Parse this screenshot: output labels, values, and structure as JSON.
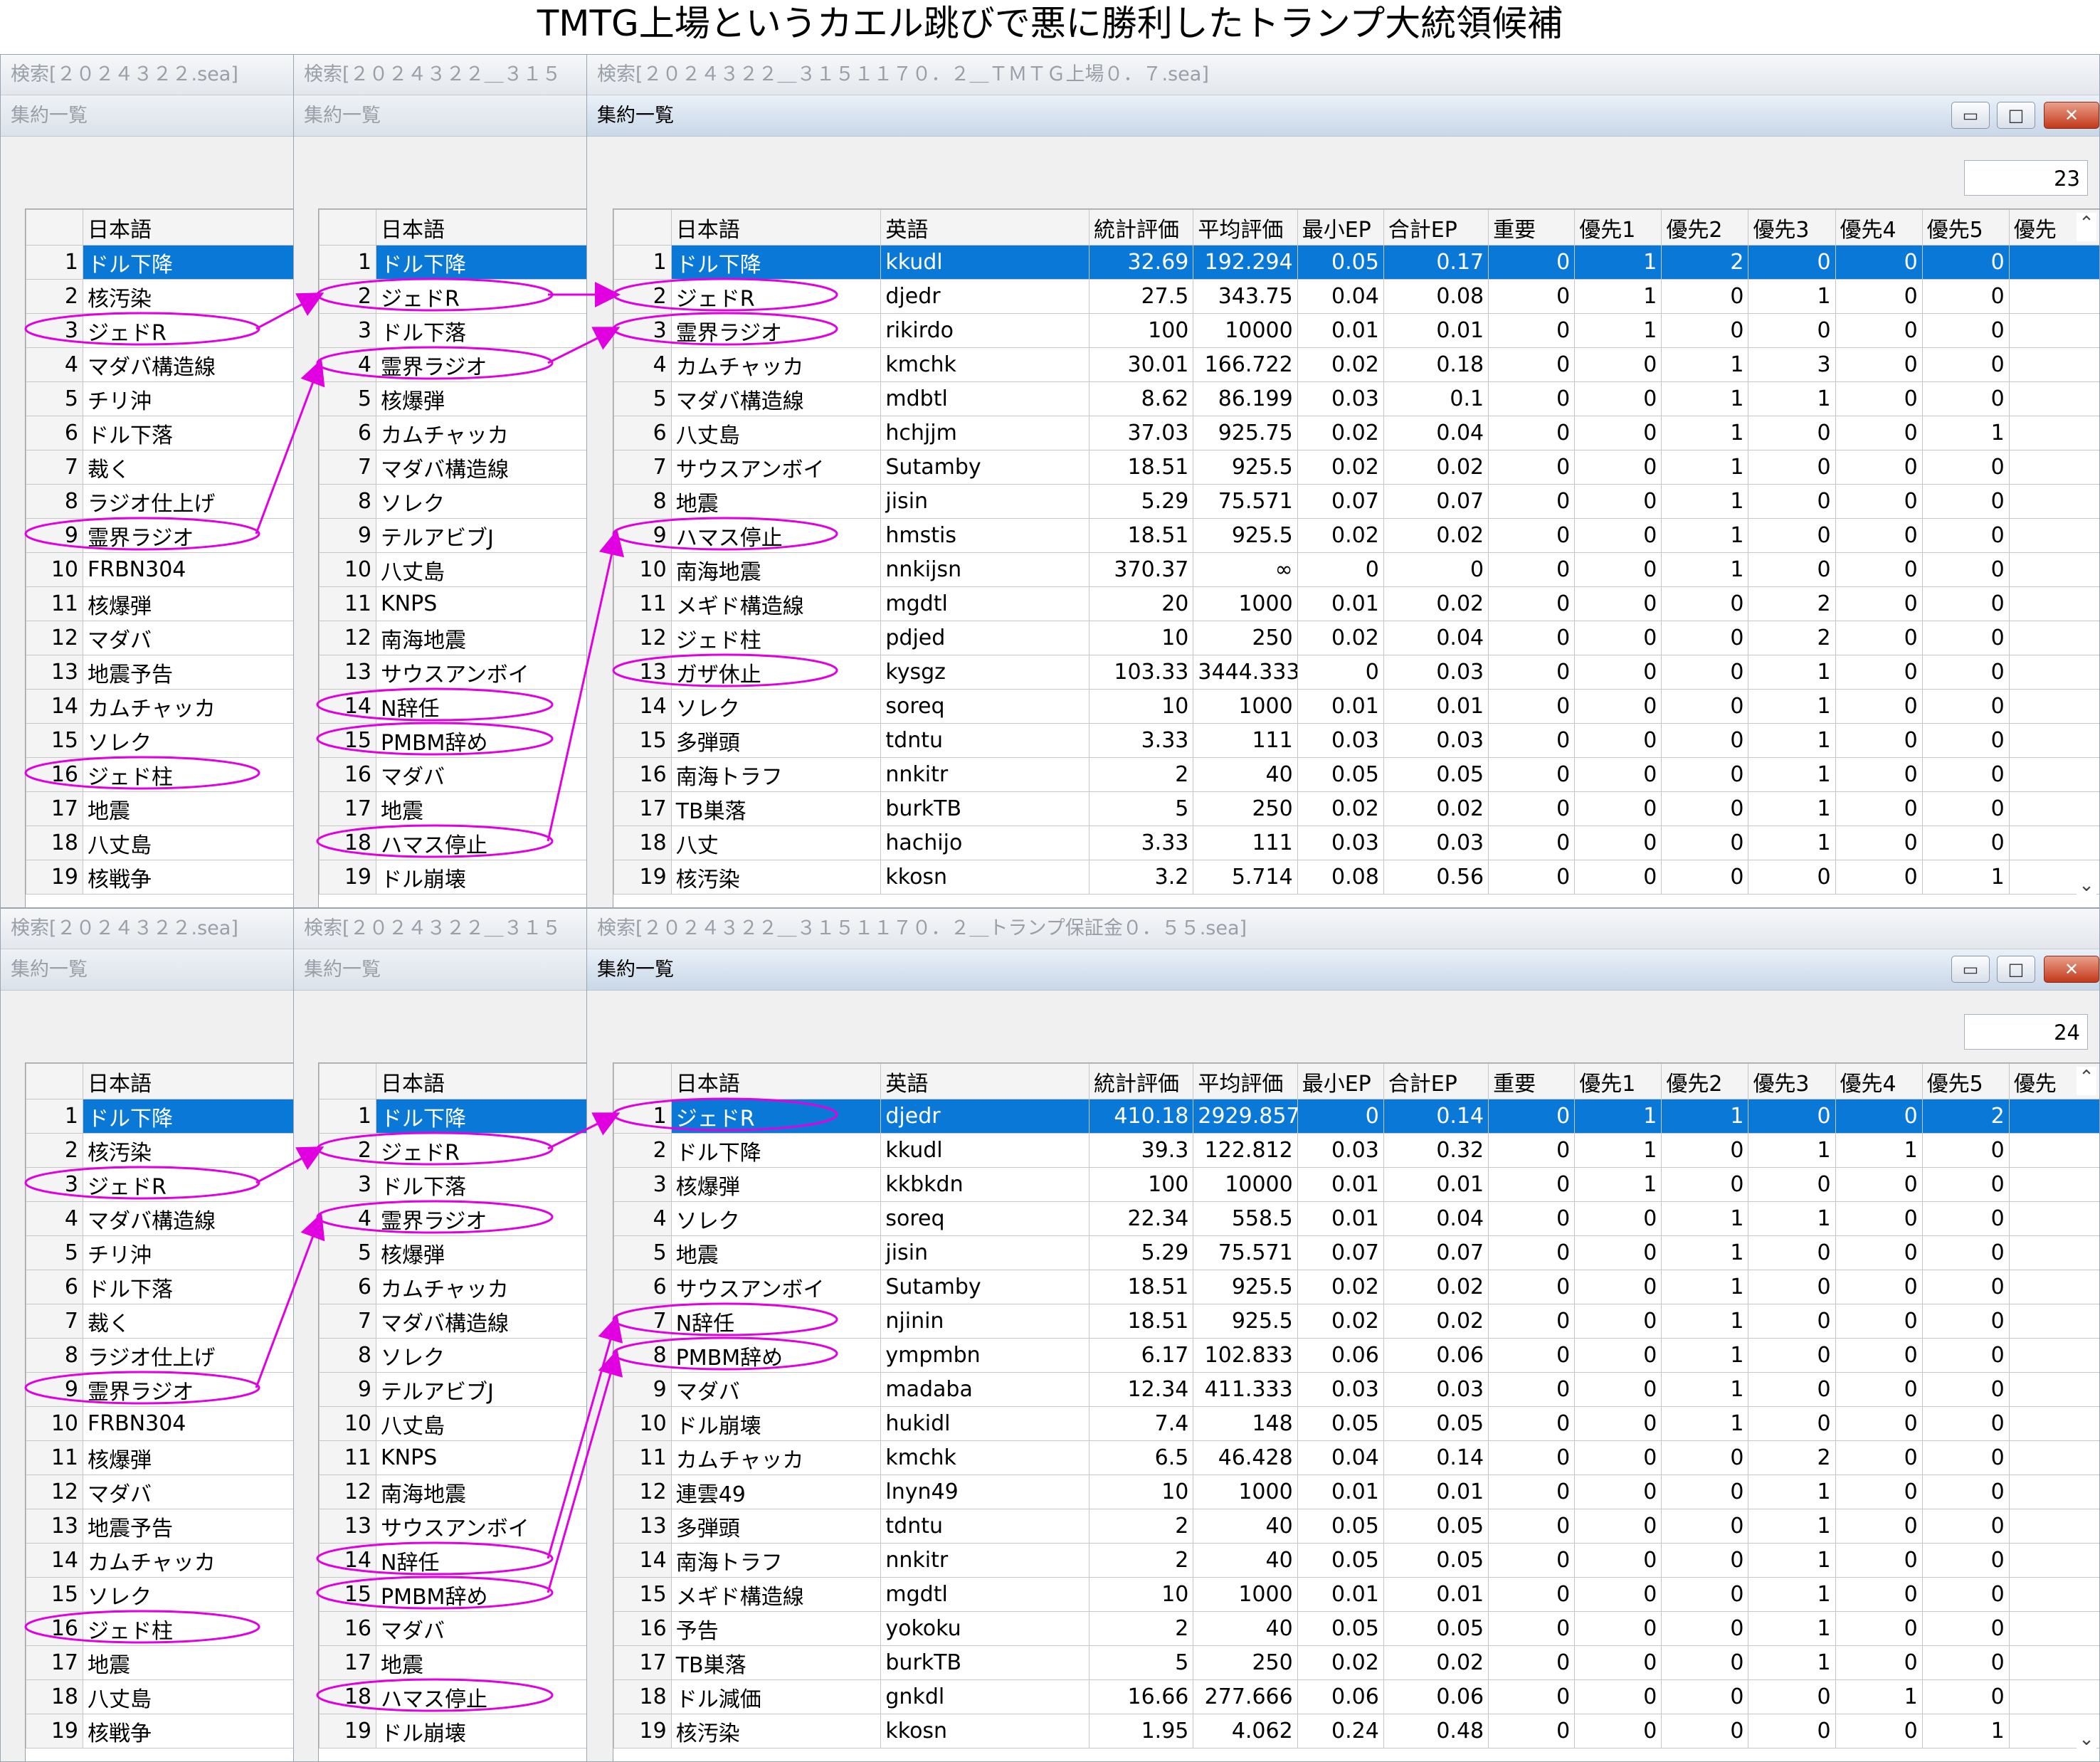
{
  "page_title": "TMTG上場というカエル跳びで悪に勝利したトランプ大統領候補",
  "blocks": [
    {
      "win1_title": "検索[２０２４３２２.sea]",
      "win2_title": "検索[２０２４３２２＿３１５",
      "win3_title": "検索[２０２４３２２＿３１５１１７０．２＿ＴＭＴＧ上場０．７.sea]",
      "sub_title": "集約一覧",
      "count": "23",
      "left_list": [
        "ドル下降",
        "核汚染",
        "ジェドR",
        "マダバ構造線",
        "チリ沖",
        "ドル下落",
        "裁く",
        "ラジオ仕上げ",
        "霊界ラジオ",
        "FRBN304",
        "核爆弾",
        "マダバ",
        "地震予告",
        "カムチャッカ",
        "ソレク",
        "ジェド柱",
        "地震",
        "八丈島",
        "核戦争"
      ],
      "mid_list": [
        "ドル下降",
        "ジェドR",
        "ドル下落",
        "霊界ラジオ",
        "核爆弾",
        "カムチャッカ",
        "マダバ構造線",
        "ソレク",
        "テルアビブJ",
        "八丈島",
        "KNPS",
        "南海地震",
        "サウスアンボイ",
        "N辞任",
        "PMBM辞め",
        "マダバ",
        "地震",
        "ハマス停止",
        "ドル崩壊"
      ],
      "rows": [
        [
          "ドル下降",
          "kkudl",
          "32.69",
          "192.294",
          "0.05",
          "0.17",
          "0",
          "1",
          "2",
          "0",
          "0",
          "0"
        ],
        [
          "ジェドR",
          "djedr",
          "27.5",
          "343.75",
          "0.04",
          "0.08",
          "0",
          "1",
          "0",
          "1",
          "0",
          "0"
        ],
        [
          "霊界ラジオ",
          "rikirdo",
          "100",
          "10000",
          "0.01",
          "0.01",
          "0",
          "1",
          "0",
          "0",
          "0",
          "0"
        ],
        [
          "カムチャッカ",
          "kmchk",
          "30.01",
          "166.722",
          "0.02",
          "0.18",
          "0",
          "0",
          "1",
          "3",
          "0",
          "0"
        ],
        [
          "マダバ構造線",
          "mdbtl",
          "8.62",
          "86.199",
          "0.03",
          "0.1",
          "0",
          "0",
          "1",
          "1",
          "0",
          "0"
        ],
        [
          "八丈島",
          "hchjjm",
          "37.03",
          "925.75",
          "0.02",
          "0.04",
          "0",
          "0",
          "1",
          "0",
          "0",
          "1"
        ],
        [
          "サウスアンボイ",
          "Sutamby",
          "18.51",
          "925.5",
          "0.02",
          "0.02",
          "0",
          "0",
          "1",
          "0",
          "0",
          "0"
        ],
        [
          "地震",
          "jisin",
          "5.29",
          "75.571",
          "0.07",
          "0.07",
          "0",
          "0",
          "1",
          "0",
          "0",
          "0"
        ],
        [
          "ハマス停止",
          "hmstis",
          "18.51",
          "925.5",
          "0.02",
          "0.02",
          "0",
          "0",
          "1",
          "0",
          "0",
          "0"
        ],
        [
          "南海地震",
          "nnkijsn",
          "370.37",
          "∞",
          "0",
          "0",
          "0",
          "0",
          "1",
          "0",
          "0",
          "0"
        ],
        [
          "メギド構造線",
          "mgdtl",
          "20",
          "1000",
          "0.01",
          "0.02",
          "0",
          "0",
          "0",
          "2",
          "0",
          "0"
        ],
        [
          "ジェド柱",
          "pdjed",
          "10",
          "250",
          "0.02",
          "0.04",
          "0",
          "0",
          "0",
          "2",
          "0",
          "0"
        ],
        [
          "ガザ休止",
          "kysgz",
          "103.33",
          "3444.333",
          "0",
          "0.03",
          "0",
          "0",
          "0",
          "1",
          "0",
          "0"
        ],
        [
          "ソレク",
          "soreq",
          "10",
          "1000",
          "0.01",
          "0.01",
          "0",
          "0",
          "0",
          "1",
          "0",
          "0"
        ],
        [
          "多弾頭",
          "tdntu",
          "3.33",
          "111",
          "0.03",
          "0.03",
          "0",
          "0",
          "0",
          "1",
          "0",
          "0"
        ],
        [
          "南海トラフ",
          "nnkitr",
          "2",
          "40",
          "0.05",
          "0.05",
          "0",
          "0",
          "0",
          "1",
          "0",
          "0"
        ],
        [
          "TB巣落",
          "burkTB",
          "5",
          "250",
          "0.02",
          "0.02",
          "0",
          "0",
          "0",
          "1",
          "0",
          "0"
        ],
        [
          "八丈",
          "hachijo",
          "3.33",
          "111",
          "0.03",
          "0.03",
          "0",
          "0",
          "0",
          "1",
          "0",
          "0"
        ],
        [
          "核汚染",
          "kkosn",
          "3.2",
          "5.714",
          "0.08",
          "0.56",
          "0",
          "0",
          "0",
          "0",
          "0",
          "1"
        ]
      ]
    },
    {
      "win1_title": "検索[２０２４３２２.sea]",
      "win2_title": "検索[２０２４３２２＿３１５",
      "win3_title": "検索[２０２４３２２＿３１５１１７０．２＿トランプ保証金０．５５.sea]",
      "sub_title": "集約一覧",
      "count": "24",
      "left_list": [
        "ドル下降",
        "核汚染",
        "ジェドR",
        "マダバ構造線",
        "チリ沖",
        "ドル下落",
        "裁く",
        "ラジオ仕上げ",
        "霊界ラジオ",
        "FRBN304",
        "核爆弾",
        "マダバ",
        "地震予告",
        "カムチャッカ",
        "ソレク",
        "ジェド柱",
        "地震",
        "八丈島",
        "核戦争"
      ],
      "mid_list": [
        "ドル下降",
        "ジェドR",
        "ドル下落",
        "霊界ラジオ",
        "核爆弾",
        "カムチャッカ",
        "マダバ構造線",
        "ソレク",
        "テルアビブJ",
        "八丈島",
        "KNPS",
        "南海地震",
        "サウスアンボイ",
        "N辞任",
        "PMBM辞め",
        "マダバ",
        "地震",
        "ハマス停止",
        "ドル崩壊"
      ],
      "rows": [
        [
          "ジェドR",
          "djedr",
          "410.18",
          "2929.857",
          "0",
          "0.14",
          "0",
          "1",
          "1",
          "0",
          "0",
          "2"
        ],
        [
          "ドル下降",
          "kkudl",
          "39.3",
          "122.812",
          "0.03",
          "0.32",
          "0",
          "1",
          "0",
          "1",
          "1",
          "0"
        ],
        [
          "核爆弾",
          "kkbkdn",
          "100",
          "10000",
          "0.01",
          "0.01",
          "0",
          "1",
          "0",
          "0",
          "0",
          "0"
        ],
        [
          "ソレク",
          "soreq",
          "22.34",
          "558.5",
          "0.01",
          "0.04",
          "0",
          "0",
          "1",
          "1",
          "0",
          "0"
        ],
        [
          "地震",
          "jisin",
          "5.29",
          "75.571",
          "0.07",
          "0.07",
          "0",
          "0",
          "1",
          "0",
          "0",
          "0"
        ],
        [
          "サウスアンボイ",
          "Sutamby",
          "18.51",
          "925.5",
          "0.02",
          "0.02",
          "0",
          "0",
          "1",
          "0",
          "0",
          "0"
        ],
        [
          "N辞任",
          "njinin",
          "18.51",
          "925.5",
          "0.02",
          "0.02",
          "0",
          "0",
          "1",
          "0",
          "0",
          "0"
        ],
        [
          "PMBM辞め",
          "ympmbn",
          "6.17",
          "102.833",
          "0.06",
          "0.06",
          "0",
          "0",
          "1",
          "0",
          "0",
          "0"
        ],
        [
          "マダバ",
          "madaba",
          "12.34",
          "411.333",
          "0.03",
          "0.03",
          "0",
          "0",
          "1",
          "0",
          "0",
          "0"
        ],
        [
          "ドル崩壊",
          "hukidl",
          "7.4",
          "148",
          "0.05",
          "0.05",
          "0",
          "0",
          "1",
          "0",
          "0",
          "0"
        ],
        [
          "カムチャッカ",
          "kmchk",
          "6.5",
          "46.428",
          "0.04",
          "0.14",
          "0",
          "0",
          "0",
          "2",
          "0",
          "0"
        ],
        [
          "連雲49",
          "lnyn49",
          "10",
          "1000",
          "0.01",
          "0.01",
          "0",
          "0",
          "0",
          "1",
          "0",
          "0"
        ],
        [
          "多弾頭",
          "tdntu",
          "2",
          "40",
          "0.05",
          "0.05",
          "0",
          "0",
          "0",
          "1",
          "0",
          "0"
        ],
        [
          "南海トラフ",
          "nnkitr",
          "2",
          "40",
          "0.05",
          "0.05",
          "0",
          "0",
          "0",
          "1",
          "0",
          "0"
        ],
        [
          "メギド構造線",
          "mgdtl",
          "10",
          "1000",
          "0.01",
          "0.01",
          "0",
          "0",
          "0",
          "1",
          "0",
          "0"
        ],
        [
          "予告",
          "yokoku",
          "2",
          "40",
          "0.05",
          "0.05",
          "0",
          "0",
          "0",
          "1",
          "0",
          "0"
        ],
        [
          "TB巣落",
          "burkTB",
          "5",
          "250",
          "0.02",
          "0.02",
          "0",
          "0",
          "0",
          "1",
          "0",
          "0"
        ],
        [
          "ドル減価",
          "gnkdl",
          "16.66",
          "277.666",
          "0.06",
          "0.06",
          "0",
          "0",
          "0",
          "0",
          "1",
          "0"
        ],
        [
          "核汚染",
          "kkosn",
          "1.95",
          "4.062",
          "0.24",
          "0.48",
          "0",
          "0",
          "0",
          "0",
          "0",
          "1"
        ]
      ]
    }
  ],
  "headers": {
    "japanese": "日本語",
    "english": "英語",
    "stat_eval": "統計評価",
    "avg_eval": "平均評価",
    "min_ep": "最小EP",
    "sum_ep": "合計EP",
    "important": "重要",
    "p1": "優先1",
    "p2": "優先2",
    "p3": "優先3",
    "p4": "優先4",
    "p5": "優先5",
    "p6": "優先"
  },
  "icons": {
    "minimize": "minimize-icon",
    "maximize": "maximize-icon",
    "close": "close-icon",
    "scroll_up": "chevron-up-icon",
    "scroll_down": "chevron-down-icon"
  },
  "colors": {
    "highlight": "#e000e0",
    "selection": "#0a78d6"
  },
  "annotations": {
    "top": {
      "left_circled": [
        3,
        9,
        16
      ],
      "mid_circled": [
        2,
        4,
        14,
        15,
        18
      ],
      "right_circled": [
        2,
        3,
        9,
        13
      ],
      "arrows": [
        [
          "L",
          3,
          "M",
          2
        ],
        [
          "L",
          9,
          "M",
          4
        ],
        [
          "M",
          2,
          "R",
          2
        ],
        [
          "M",
          4,
          "R",
          3
        ],
        [
          "M",
          18,
          "R",
          9
        ]
      ]
    },
    "bottom": {
      "left_circled": [
        3,
        9,
        16
      ],
      "mid_circled": [
        2,
        4,
        14,
        15,
        18
      ],
      "right_circled": [
        1,
        7,
        8
      ],
      "arrows": [
        [
          "L",
          3,
          "M",
          2
        ],
        [
          "L",
          9,
          "M",
          4
        ],
        [
          "M",
          2,
          "R",
          1
        ],
        [
          "M",
          14,
          "R",
          7
        ],
        [
          "M",
          15,
          "R",
          8
        ]
      ]
    }
  }
}
